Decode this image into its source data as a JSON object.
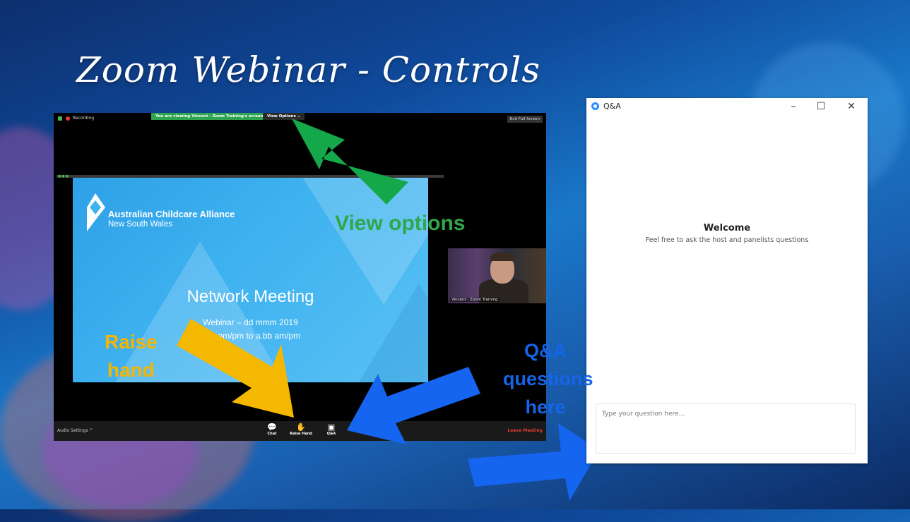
{
  "slide": {
    "title": "Zoom Webinar - Controls"
  },
  "zoom": {
    "recording": "Recording",
    "viewing_banner": "You are viewing Vincent - Zoom Training's screen",
    "view_options": "View Options ⌄",
    "exit_full_screen": "Exit Full Screen",
    "shared_slide": {
      "org_name": "Australian Childcare Alliance",
      "org_sub": "New South Wales",
      "title": "Network Meeting",
      "line1": "Webinar – dd mmm 2019",
      "line2": "x.yy am/pm to a.bb am/pm"
    },
    "video_label": "Vincent - Zoom Training",
    "audio_settings": "Audio Settings",
    "controls": [
      {
        "label": "Chat",
        "icon": "chat-icon",
        "glyph": "💬"
      },
      {
        "label": "Raise Hand",
        "icon": "raise-hand-icon",
        "glyph": "✋"
      },
      {
        "label": "Q&A",
        "icon": "qa-icon",
        "glyph": "▣"
      }
    ],
    "leave_meeting": "Leave Meeting"
  },
  "annotations": {
    "view_options": "View options",
    "raise_hand_1": "Raise",
    "raise_hand_2": "hand",
    "qa_1": "Q&A",
    "qa_2": "questions",
    "qa_3": "here",
    "colors": {
      "green": "#2ea84a",
      "yellow": "#f5b500",
      "blue": "#1565e8"
    }
  },
  "qa_window": {
    "title": "Q&A",
    "welcome": "Welcome",
    "description": "Feel free to ask the host and panelists questions",
    "input_placeholder": "Type your question here...",
    "input_value": ""
  }
}
